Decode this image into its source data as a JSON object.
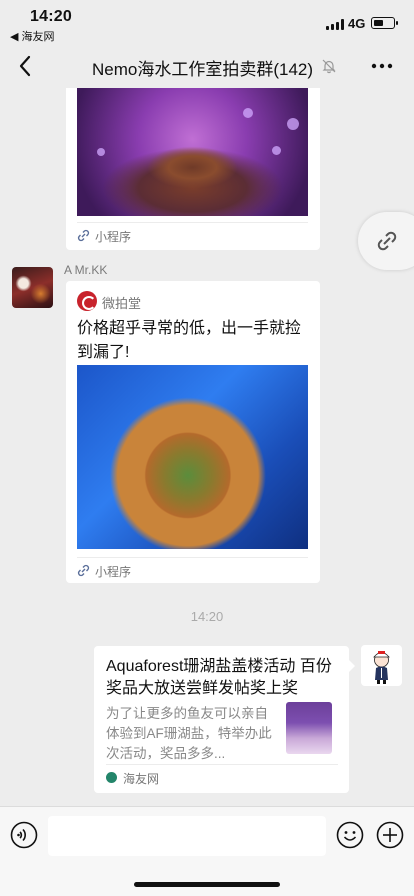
{
  "status_bar": {
    "time": "14:20",
    "back_app": "◀ 海友网",
    "network": "4G"
  },
  "nav": {
    "title": "Nemo海水工作室拍卖群(142)",
    "back_icon": "chevron-left-icon",
    "mute_icon": "bell-off-icon",
    "more_icon": "ellipsis-icon"
  },
  "messages": {
    "first_card": {
      "footer_label": "小程序"
    },
    "second": {
      "sender": "A  Mr.KK",
      "brand": "微拍堂",
      "text": "价格超乎寻常的低，出一手就捡到漏了!",
      "footer_label": "小程序"
    },
    "time_divider": "14:20",
    "link_card": {
      "title": "Aquaforest珊湖盐盖楼活动 百份奖品大放送尝鲜发帖奖上奖",
      "desc": "为了让更多的鱼友可以亲自体验到AF珊湖盐，特举办此次活动，奖品多多...",
      "source": "海友网"
    }
  },
  "input_bar": {
    "voice_icon": "voice-icon",
    "emoji_icon": "emoji-icon",
    "plus_icon": "plus-icon"
  },
  "colors": {
    "background": "#ededed",
    "bubble": "#ffffff",
    "brand_red": "#c8232c",
    "muted_text": "#888888"
  }
}
